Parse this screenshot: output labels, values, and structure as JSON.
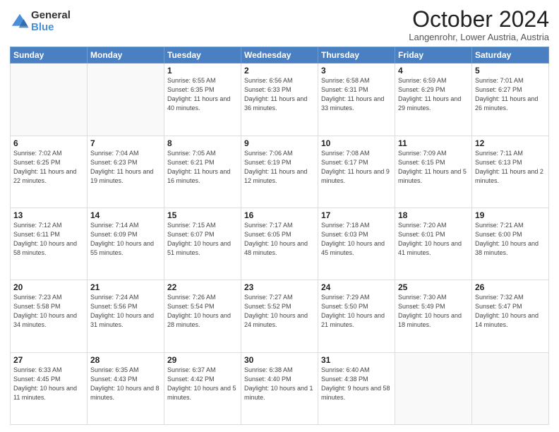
{
  "logo": {
    "general": "General",
    "blue": "Blue"
  },
  "title": "October 2024",
  "location": "Langenrohr, Lower Austria, Austria",
  "days_of_week": [
    "Sunday",
    "Monday",
    "Tuesday",
    "Wednesday",
    "Thursday",
    "Friday",
    "Saturday"
  ],
  "weeks": [
    [
      {
        "day": "",
        "info": ""
      },
      {
        "day": "",
        "info": ""
      },
      {
        "day": "1",
        "info": "Sunrise: 6:55 AM\nSunset: 6:35 PM\nDaylight: 11 hours and 40 minutes."
      },
      {
        "day": "2",
        "info": "Sunrise: 6:56 AM\nSunset: 6:33 PM\nDaylight: 11 hours and 36 minutes."
      },
      {
        "day": "3",
        "info": "Sunrise: 6:58 AM\nSunset: 6:31 PM\nDaylight: 11 hours and 33 minutes."
      },
      {
        "day": "4",
        "info": "Sunrise: 6:59 AM\nSunset: 6:29 PM\nDaylight: 11 hours and 29 minutes."
      },
      {
        "day": "5",
        "info": "Sunrise: 7:01 AM\nSunset: 6:27 PM\nDaylight: 11 hours and 26 minutes."
      }
    ],
    [
      {
        "day": "6",
        "info": "Sunrise: 7:02 AM\nSunset: 6:25 PM\nDaylight: 11 hours and 22 minutes."
      },
      {
        "day": "7",
        "info": "Sunrise: 7:04 AM\nSunset: 6:23 PM\nDaylight: 11 hours and 19 minutes."
      },
      {
        "day": "8",
        "info": "Sunrise: 7:05 AM\nSunset: 6:21 PM\nDaylight: 11 hours and 16 minutes."
      },
      {
        "day": "9",
        "info": "Sunrise: 7:06 AM\nSunset: 6:19 PM\nDaylight: 11 hours and 12 minutes."
      },
      {
        "day": "10",
        "info": "Sunrise: 7:08 AM\nSunset: 6:17 PM\nDaylight: 11 hours and 9 minutes."
      },
      {
        "day": "11",
        "info": "Sunrise: 7:09 AM\nSunset: 6:15 PM\nDaylight: 11 hours and 5 minutes."
      },
      {
        "day": "12",
        "info": "Sunrise: 7:11 AM\nSunset: 6:13 PM\nDaylight: 11 hours and 2 minutes."
      }
    ],
    [
      {
        "day": "13",
        "info": "Sunrise: 7:12 AM\nSunset: 6:11 PM\nDaylight: 10 hours and 58 minutes."
      },
      {
        "day": "14",
        "info": "Sunrise: 7:14 AM\nSunset: 6:09 PM\nDaylight: 10 hours and 55 minutes."
      },
      {
        "day": "15",
        "info": "Sunrise: 7:15 AM\nSunset: 6:07 PM\nDaylight: 10 hours and 51 minutes."
      },
      {
        "day": "16",
        "info": "Sunrise: 7:17 AM\nSunset: 6:05 PM\nDaylight: 10 hours and 48 minutes."
      },
      {
        "day": "17",
        "info": "Sunrise: 7:18 AM\nSunset: 6:03 PM\nDaylight: 10 hours and 45 minutes."
      },
      {
        "day": "18",
        "info": "Sunrise: 7:20 AM\nSunset: 6:01 PM\nDaylight: 10 hours and 41 minutes."
      },
      {
        "day": "19",
        "info": "Sunrise: 7:21 AM\nSunset: 6:00 PM\nDaylight: 10 hours and 38 minutes."
      }
    ],
    [
      {
        "day": "20",
        "info": "Sunrise: 7:23 AM\nSunset: 5:58 PM\nDaylight: 10 hours and 34 minutes."
      },
      {
        "day": "21",
        "info": "Sunrise: 7:24 AM\nSunset: 5:56 PM\nDaylight: 10 hours and 31 minutes."
      },
      {
        "day": "22",
        "info": "Sunrise: 7:26 AM\nSunset: 5:54 PM\nDaylight: 10 hours and 28 minutes."
      },
      {
        "day": "23",
        "info": "Sunrise: 7:27 AM\nSunset: 5:52 PM\nDaylight: 10 hours and 24 minutes."
      },
      {
        "day": "24",
        "info": "Sunrise: 7:29 AM\nSunset: 5:50 PM\nDaylight: 10 hours and 21 minutes."
      },
      {
        "day": "25",
        "info": "Sunrise: 7:30 AM\nSunset: 5:49 PM\nDaylight: 10 hours and 18 minutes."
      },
      {
        "day": "26",
        "info": "Sunrise: 7:32 AM\nSunset: 5:47 PM\nDaylight: 10 hours and 14 minutes."
      }
    ],
    [
      {
        "day": "27",
        "info": "Sunrise: 6:33 AM\nSunset: 4:45 PM\nDaylight: 10 hours and 11 minutes."
      },
      {
        "day": "28",
        "info": "Sunrise: 6:35 AM\nSunset: 4:43 PM\nDaylight: 10 hours and 8 minutes."
      },
      {
        "day": "29",
        "info": "Sunrise: 6:37 AM\nSunset: 4:42 PM\nDaylight: 10 hours and 5 minutes."
      },
      {
        "day": "30",
        "info": "Sunrise: 6:38 AM\nSunset: 4:40 PM\nDaylight: 10 hours and 1 minute."
      },
      {
        "day": "31",
        "info": "Sunrise: 6:40 AM\nSunset: 4:38 PM\nDaylight: 9 hours and 58 minutes."
      },
      {
        "day": "",
        "info": ""
      },
      {
        "day": "",
        "info": ""
      }
    ]
  ]
}
